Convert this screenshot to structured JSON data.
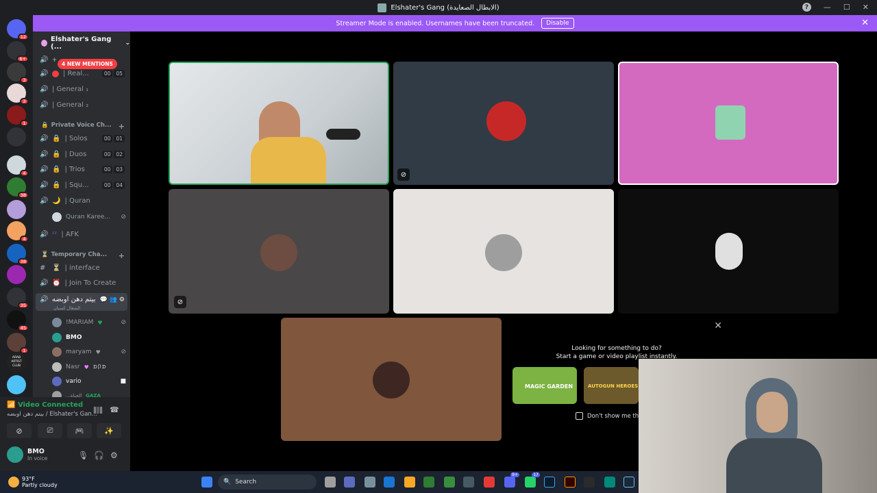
{
  "window": {
    "title": "Elshater's Gang (الابطال الصعايدة)"
  },
  "streamer_mode": {
    "message": "Streamer Mode is enabled. Usernames have been truncated.",
    "button": "Disable"
  },
  "servers": [
    {
      "badge": "12",
      "color": "#5865f2"
    },
    {
      "badge": "6+",
      "color": "#313338"
    },
    {
      "badge": "3",
      "color": "#3a3a3a"
    },
    {
      "badge": "3",
      "color": "#e8d8d8"
    },
    {
      "badge": "1",
      "color": "#8b1a1a"
    },
    {
      "badge": "",
      "color": "#313338"
    },
    {
      "badge": "4",
      "color": "#cfd8dc"
    },
    {
      "badge": "38",
      "color": "#2e7d32"
    },
    {
      "badge": "",
      "color": "#b39ddb"
    },
    {
      "badge": "4",
      "color": "#f4a261"
    },
    {
      "badge": "38",
      "color": "#1565c0"
    },
    {
      "badge": "",
      "color": "#9c27b0"
    },
    {
      "badge": "35",
      "color": "#313338"
    },
    {
      "badge": "45",
      "color": "#111111"
    },
    {
      "badge": "1",
      "color": "#5d4037"
    },
    {
      "badge": "ARAB ARTIST CLUB",
      "color": "#222222"
    },
    {
      "badge": "",
      "color": "#4fc3f7"
    }
  ],
  "sidebar": {
    "guild_name": "Elshater's Gang (...",
    "mentions": "4 NEW MENTIONS",
    "channels_top": [
      {
        "name": "| Real...",
        "c1": "00",
        "c2": "05"
      },
      {
        "name": "| General ₁"
      },
      {
        "name": "| General ₂"
      }
    ],
    "cat_private": "Private Voice Ch...",
    "private": [
      {
        "name": "| Solos",
        "c1": "00",
        "c2": "01"
      },
      {
        "name": "| Duos",
        "c1": "00",
        "c2": "02"
      },
      {
        "name": "| Trios",
        "c1": "00",
        "c2": "03"
      },
      {
        "name": "| Squ...",
        "c1": "00",
        "c2": "04"
      },
      {
        "name": "| Quran"
      }
    ],
    "quran_user": "Quran Karee...",
    "afk": "| AFK",
    "cat_temp": "Temporary Cha...",
    "interface": "| interface",
    "join": "| Join To Create",
    "active_channel": "بيتم دهن اوبضه",
    "active_sub": "الشغال كسبان",
    "voice_users": [
      {
        "name": "!MARIAM",
        "color": "#7b8a9a"
      },
      {
        "name": "BMO",
        "color": "#2a9d8f"
      },
      {
        "name": "maryam",
        "color": "#8d6e63"
      },
      {
        "name": "Nasr",
        "tag": "ᗪ卩ᗪ",
        "color": "#bdbdbd"
      },
      {
        "name": "vario",
        "color": "#5c6bc0"
      },
      {
        "name": "...الحياة",
        "tag": "GAZA",
        "color": "#9e9e9e"
      }
    ]
  },
  "voice_panel": {
    "status": "Video Connected",
    "channel": "بيتم دهن اوبضه / Elshater's Gan...",
    "user": "BMO",
    "user_status": "In voice"
  },
  "popup": {
    "title": "Looking for something to do?",
    "subtitle": "Start a game or video playlist instantly.",
    "games": [
      "MAGIC GARDEN",
      "AUTOGUN HEROES"
    ],
    "checkbox": "Don't show me this"
  },
  "taskbar": {
    "weather_temp": "93°F",
    "weather_desc": "Partly cloudy",
    "search": "Search",
    "discord_badge": "9+",
    "whatsapp_badge": "17"
  }
}
